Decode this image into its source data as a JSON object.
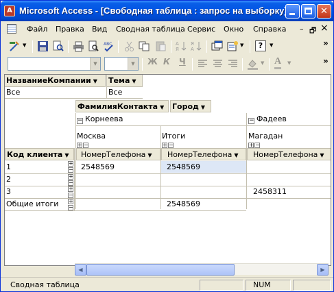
{
  "window": {
    "title": "Microsoft Access - [Свободная таблица : запрос на выборку]",
    "icon_letter": "A",
    "controls": [
      "minimize-icon",
      "maximize-icon",
      "close-icon"
    ],
    "close_glyph": "✕"
  },
  "menu": {
    "items": [
      "Файл",
      "Правка",
      "Вид",
      "Сводная таблица",
      "Сервис",
      "Окно",
      "Справка"
    ],
    "mdi_minimize": "–",
    "mdi_restore": "🗗",
    "mdi_close": "×"
  },
  "toolbar": {
    "help_label": "?",
    "format_buttons": [
      "Ж",
      "К",
      "Ч"
    ],
    "font_color_letter": "A",
    "overflow": "»"
  },
  "pivot": {
    "filter_fields": [
      {
        "name": "НазваниеКомпании",
        "value": "Все"
      },
      {
        "name": "Тема",
        "value": "Все"
      }
    ],
    "column_fields": [
      "ФамилияКонтакта",
      "Город"
    ],
    "column_groups": [
      {
        "contact": "Корнеева",
        "cities": [
          "Москва",
          "Итоги"
        ]
      },
      {
        "contact": "Фадеев",
        "cities": [
          "Магадан"
        ]
      }
    ],
    "row_field": "Код клиента",
    "data_field": "НомерТелефона",
    "expand_sign": "⊟",
    "rows": [
      {
        "key": "1",
        "values": [
          "2548569",
          "2548569",
          ""
        ]
      },
      {
        "key": "2",
        "values": [
          "",
          "",
          ""
        ]
      },
      {
        "key": "3",
        "values": [
          "",
          "",
          "2458311"
        ]
      },
      {
        "key": "Общие итоги",
        "values": [
          "",
          "2548569",
          ""
        ]
      }
    ]
  },
  "statusbar": {
    "text": "Сводная таблица",
    "num": "NUM"
  },
  "colors": {
    "titlebar": "#0054e3",
    "chrome": "#ece9d8",
    "selected_cell": "#dde7f6"
  }
}
